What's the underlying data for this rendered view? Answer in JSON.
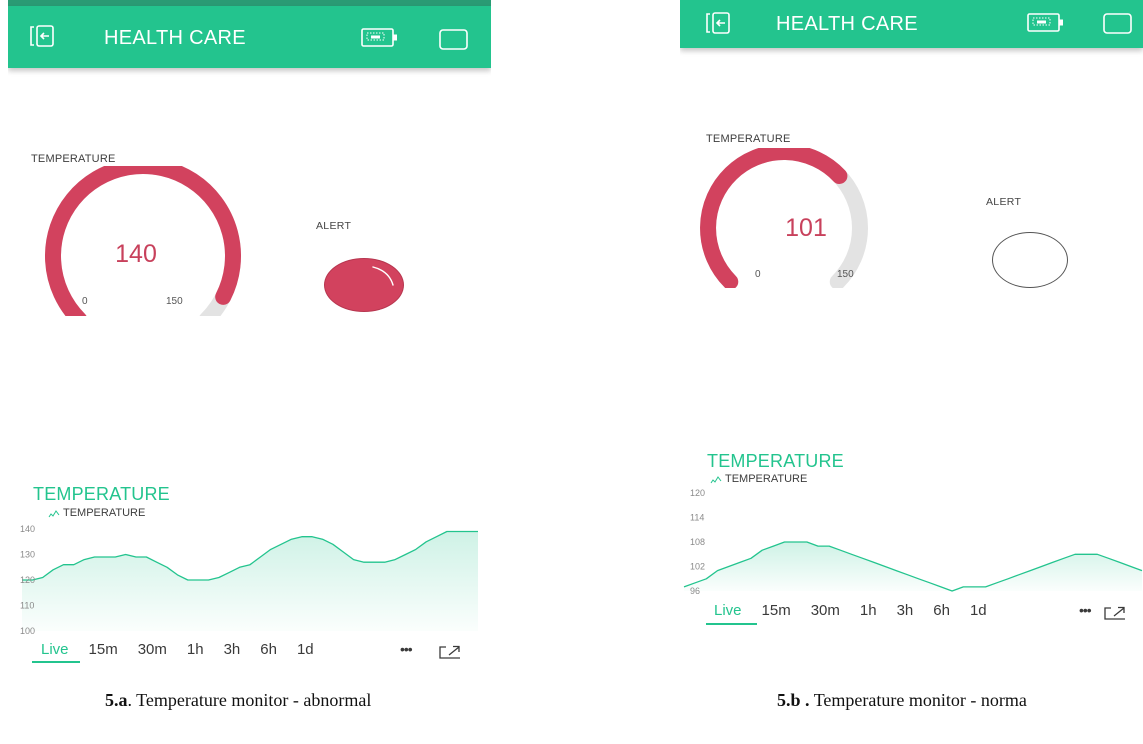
{
  "colors": {
    "accent": "#23c48e",
    "alert_red": "#d2425e",
    "track": "#e3e3e3"
  },
  "screens": [
    {
      "app_title": "HEALTH CARE",
      "icons": [
        "exit-icon",
        "device-icon",
        "square-icon"
      ],
      "gauge": {
        "label": "TEMPERATURE",
        "value": "140",
        "min": "0",
        "max": "150"
      },
      "alert": {
        "label": "ALERT",
        "state": "on"
      },
      "chart": {
        "title": "TEMPERATURE",
        "legend": "TEMPERATURE",
        "y_ticks": [
          "140",
          "130",
          "120",
          "110",
          "100"
        ],
        "ranges": [
          "Live",
          "15m",
          "30m",
          "1h",
          "3h",
          "6h",
          "1d"
        ],
        "more": "•••"
      },
      "caption": {
        "bold": "5.a",
        "text": ". Temperature monitor - abnormal"
      }
    },
    {
      "app_title": "HEALTH CARE",
      "icons": [
        "exit-icon",
        "device-icon",
        "square-icon"
      ],
      "gauge": {
        "label": "TEMPERATURE",
        "value": "101",
        "min": "0",
        "max": "150"
      },
      "alert": {
        "label": "ALERT",
        "state": "off"
      },
      "chart": {
        "title": "TEMPERATURE",
        "legend": "TEMPERATURE",
        "y_ticks": [
          "120",
          "114",
          "108",
          "102",
          "96"
        ],
        "ranges": [
          "Live",
          "15m",
          "30m",
          "1h",
          "3h",
          "6h",
          "1d"
        ],
        "more": "•••"
      },
      "caption": {
        "bold": "5.b .",
        "text": " Temperature monitor - norma"
      }
    }
  ],
  "chart_data": [
    {
      "type": "area",
      "ylim": [
        100,
        140
      ],
      "series": [
        {
          "values": [
            120,
            120,
            121,
            124,
            126,
            126,
            128,
            129,
            129,
            129,
            130,
            129,
            129,
            127,
            125,
            122,
            120,
            120,
            120,
            121,
            123,
            125,
            126,
            129,
            132,
            134,
            136,
            137,
            137,
            136,
            134,
            131,
            128,
            127,
            127,
            127,
            128,
            130,
            132,
            135,
            137,
            139,
            139,
            139,
            139
          ]
        }
      ]
    },
    {
      "type": "area",
      "ylim": [
        96,
        120
      ],
      "series": [
        {
          "values": [
            97,
            98,
            99,
            101,
            102,
            103,
            104,
            106,
            107,
            108,
            108,
            108,
            107,
            107,
            106,
            105,
            104,
            103,
            102,
            101,
            100,
            99,
            98,
            97,
            96,
            97,
            97,
            97,
            98,
            99,
            100,
            101,
            102,
            103,
            104,
            105,
            105,
            105,
            104,
            103,
            102,
            101
          ]
        }
      ]
    }
  ]
}
